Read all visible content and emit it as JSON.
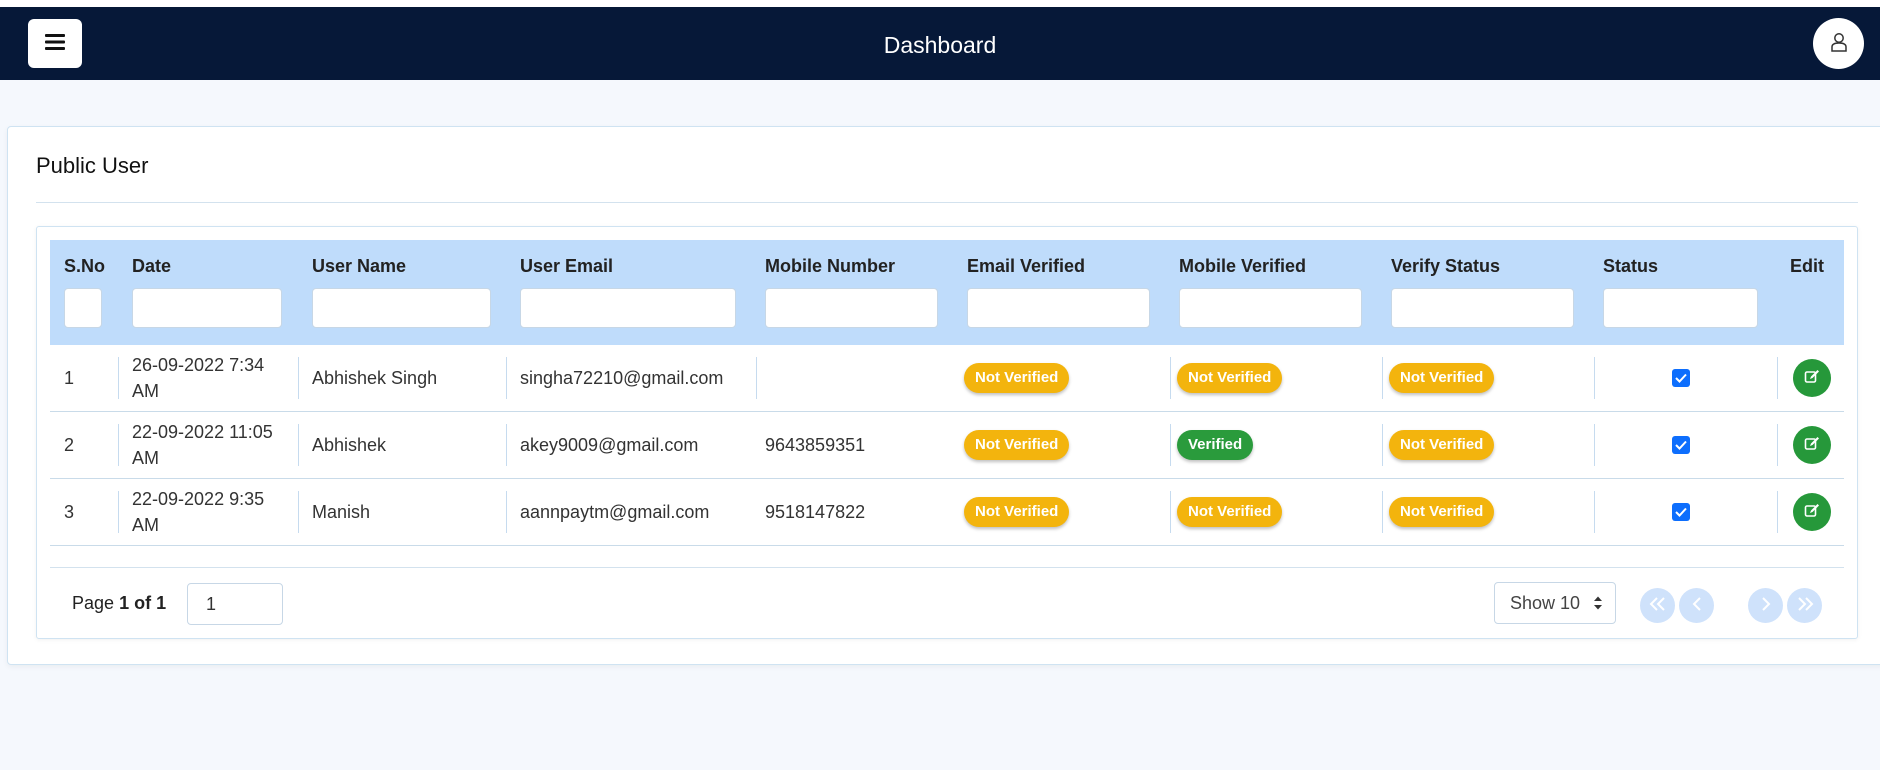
{
  "navbar": {
    "title": "Dashboard",
    "menu_icon": "hamburger-icon",
    "user_icon": "user-icon",
    "background": "#061838"
  },
  "card": {
    "title": "Public User"
  },
  "table": {
    "headers": {
      "sno": "S.No",
      "date": "Date",
      "user_name": "User Name",
      "user_email": "User Email",
      "mobile_number": "Mobile Number",
      "email_verified": "Email Verified",
      "mobile_verified": "Mobile Verified",
      "verify_status": "Verify Status",
      "status": "Status",
      "edit": "Edit"
    },
    "header_bg": "#bfdcfb",
    "rows": [
      {
        "sno": "1",
        "date_line1": "26-09-2022 7:34",
        "date_line2": "AM",
        "user_name": "Abhishek Singh",
        "user_email": "singha72210@gmail.com",
        "mobile_number": "",
        "email_verified": "Not Verified",
        "mobile_verified": "Not Verified",
        "verify_status": "Not Verified",
        "status_checked": true
      },
      {
        "sno": "2",
        "date_line1": "22-09-2022 11:05",
        "date_line2": "AM",
        "user_name": "Abhishek",
        "user_email": "akey9009@gmail.com",
        "mobile_number": "9643859351",
        "email_verified": "Not Verified",
        "mobile_verified": "Verified",
        "verify_status": "Not Verified",
        "status_checked": true
      },
      {
        "sno": "3",
        "date_line1": "22-09-2022 9:35",
        "date_line2": "AM",
        "user_name": "Manish",
        "user_email": "aannpaytm@gmail.com",
        "mobile_number": "9518147822",
        "email_verified": "Not Verified",
        "mobile_verified": "Not Verified",
        "verify_status": "Not Verified",
        "status_checked": true
      }
    ],
    "colors": {
      "not_verified": "#f3b40d",
      "verified": "#2a9b3c",
      "edit_button": "#26983a",
      "checkbox": "#0d6efd"
    }
  },
  "pagination": {
    "page_prefix": "Page",
    "page_current": "1 of 1",
    "page_input_value": "1",
    "show_select": "Show 10",
    "buttons": [
      "first-page-icon",
      "previous-page-icon",
      "next-page-icon",
      "last-page-icon"
    ]
  }
}
